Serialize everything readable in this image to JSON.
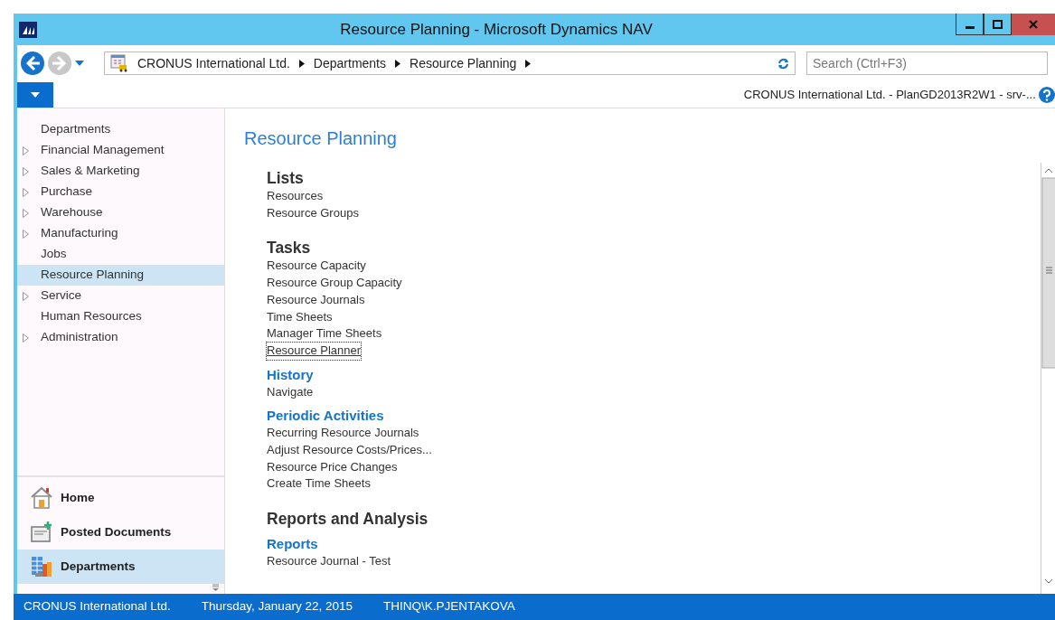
{
  "window": {
    "title": "Resource Planning - Microsoft Dynamics NAV"
  },
  "navigation": {
    "back_enabled": true,
    "forward_enabled": false,
    "breadcrumb": [
      "CRONUS International Ltd.",
      "Departments",
      "Resource Planning"
    ],
    "search": {
      "placeholder": "Search (Ctrl+F3)"
    }
  },
  "connection_info": "CRONUS International Ltd. - PlanGD2013R2W1 - srv-...",
  "sidebar": {
    "items": [
      {
        "label": "Departments",
        "expandable": false,
        "selected": false
      },
      {
        "label": "Financial Management",
        "expandable": true,
        "selected": false
      },
      {
        "label": "Sales & Marketing",
        "expandable": true,
        "selected": false
      },
      {
        "label": "Purchase",
        "expandable": true,
        "selected": false
      },
      {
        "label": "Warehouse",
        "expandable": true,
        "selected": false
      },
      {
        "label": "Manufacturing",
        "expandable": true,
        "selected": false
      },
      {
        "label": "Jobs",
        "expandable": false,
        "selected": false
      },
      {
        "label": "Resource Planning",
        "expandable": false,
        "selected": true
      },
      {
        "label": "Service",
        "expandable": true,
        "selected": false
      },
      {
        "label": "Human Resources",
        "expandable": false,
        "selected": false
      },
      {
        "label": "Administration",
        "expandable": true,
        "selected": false
      }
    ],
    "buttons": [
      {
        "label": "Home",
        "kind": "home",
        "selected": false
      },
      {
        "label": "Posted Documents",
        "kind": "posted",
        "selected": false
      },
      {
        "label": "Departments",
        "kind": "departments",
        "selected": true
      }
    ]
  },
  "content": {
    "title": "Resource Planning",
    "sections": [
      {
        "heading": "Lists",
        "kind": "category",
        "items": [
          {
            "label": "Resources",
            "focused": false
          },
          {
            "label": "Resource Groups",
            "focused": false
          }
        ]
      },
      {
        "heading": "Tasks",
        "kind": "category",
        "items": [
          {
            "label": "Resource Capacity",
            "focused": false
          },
          {
            "label": "Resource Group Capacity",
            "focused": false
          },
          {
            "label": "Resource Journals",
            "focused": false
          },
          {
            "label": "Time Sheets",
            "focused": false
          },
          {
            "label": "Manager Time Sheets",
            "focused": false
          },
          {
            "label": "Resource Planner",
            "focused": true
          }
        ]
      },
      {
        "heading": "History",
        "kind": "group",
        "items": [
          {
            "label": "Navigate",
            "focused": false
          }
        ]
      },
      {
        "heading": "Periodic Activities",
        "kind": "group",
        "items": [
          {
            "label": "Recurring Resource Journals",
            "focused": false
          },
          {
            "label": "Adjust Resource Costs/Prices...",
            "focused": false
          },
          {
            "label": "Resource Price Changes",
            "focused": false
          },
          {
            "label": "Create Time Sheets",
            "focused": false
          }
        ]
      },
      {
        "heading": "Reports and Analysis",
        "kind": "category"
      },
      {
        "heading": "Reports",
        "kind": "group",
        "items": [
          {
            "label": "Resource Journal - Test",
            "focused": false
          }
        ]
      }
    ]
  },
  "status_bar": [
    "CRONUS International Ltd.",
    "Thursday, January 22, 2015",
    "THINQ\\K.PJENTAKOVA"
  ]
}
